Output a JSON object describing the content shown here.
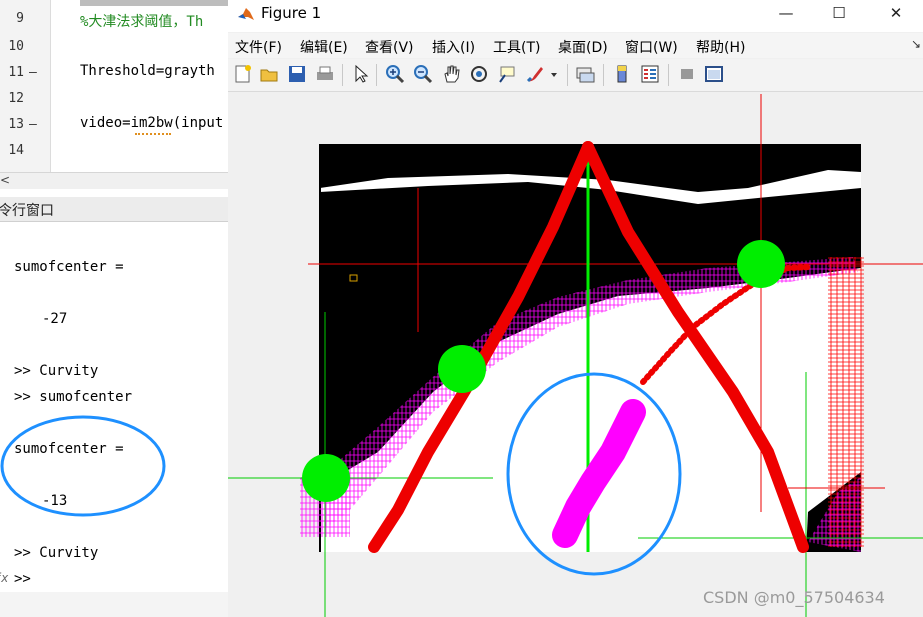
{
  "editor": {
    "lines": [
      {
        "num": "9",
        "dash": "",
        "code": "%大津法求阈值，Th",
        "comment": true
      },
      {
        "num": "10",
        "dash": "",
        "code": "",
        "comment": false
      },
      {
        "num": "11",
        "dash": "—",
        "code": "Threshold=grayth",
        "comment": false
      },
      {
        "num": "12",
        "dash": "",
        "code": "",
        "comment": false
      },
      {
        "num": "13",
        "dash": "—",
        "code": "video=im2bw(input",
        "comment": false
      },
      {
        "num": "14",
        "dash": "",
        "code": "",
        "comment": false
      }
    ],
    "scroll_arrow": "<"
  },
  "command_window": {
    "title": "令行窗口",
    "lines": [
      "sumofcenter =",
      "-27",
      ">> Curvity",
      ">> sumofcenter",
      "sumofcenter =",
      "-13",
      ">> Curvity",
      ">>"
    ],
    "prompt_prefix": "fx"
  },
  "figure": {
    "title": "Figure 1",
    "window_buttons": {
      "minimize": "—",
      "maximize": "☐",
      "close": "✕"
    },
    "menus": [
      "文件(F)",
      "编辑(E)",
      "查看(V)",
      "插入(I)",
      "工具(T)",
      "桌面(D)",
      "窗口(W)",
      "帮助(H)"
    ],
    "menu_dock": "↘",
    "toolbar_icons": [
      "new-figure-icon",
      "open-icon",
      "save-icon",
      "print-icon",
      "pointer-icon",
      "zoom-in-icon",
      "zoom-out-icon",
      "pan-icon",
      "rotate-3d-icon",
      "data-cursor-icon",
      "brush-icon",
      "brush-dropdown-icon",
      "link-plot-icon",
      "colorbar-icon",
      "legend-icon",
      "hide-tools-icon",
      "dock-icon"
    ]
  },
  "colors": {
    "red_line": "#ee0000",
    "green_marker": "#00ee00",
    "magenta": "#ff00ff",
    "annotation_circle": "#1e90ff",
    "road_black": "#000000",
    "road_white": "#ffffff"
  },
  "watermark": "CSDN @m0_57504634"
}
